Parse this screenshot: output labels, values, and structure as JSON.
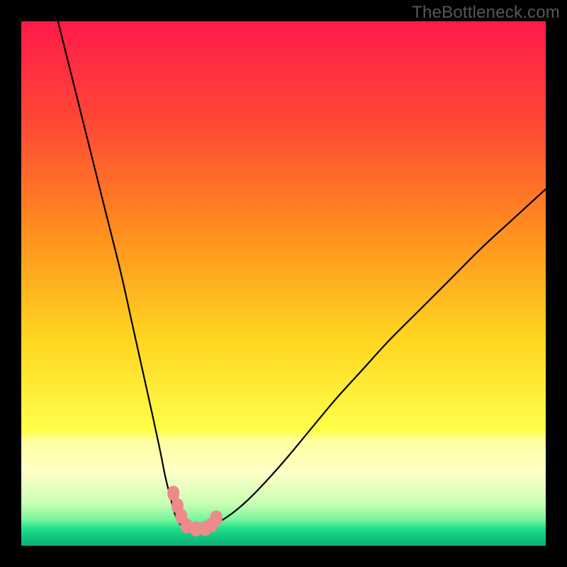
{
  "watermark": "TheBottleneck.com",
  "chart_data": {
    "type": "line",
    "title": "",
    "xlabel": "",
    "ylabel": "",
    "xlim": [
      0,
      100
    ],
    "ylim": [
      0,
      100
    ],
    "background_gradient": {
      "stops": [
        {
          "offset": 0.0,
          "color": "#ff1a49"
        },
        {
          "offset": 0.2,
          "color": "#ff4a34"
        },
        {
          "offset": 0.4,
          "color": "#ff8e1f"
        },
        {
          "offset": 0.6,
          "color": "#ffd41f"
        },
        {
          "offset": 0.78,
          "color": "#ffff4a"
        },
        {
          "offset": 0.8,
          "color": "#ffffa0"
        },
        {
          "offset": 0.86,
          "color": "#ffffc8"
        },
        {
          "offset": 0.92,
          "color": "#c8ffb4"
        },
        {
          "offset": 0.95,
          "color": "#78f59b"
        },
        {
          "offset": 0.967,
          "color": "#22e08a"
        },
        {
          "offset": 0.982,
          "color": "#12c880"
        },
        {
          "offset": 1.0,
          "color": "#0fb074"
        }
      ]
    },
    "series": [
      {
        "name": "left-curve",
        "color": "#000000",
        "width": 2.2,
        "x": [
          7,
          10,
          13,
          16,
          19,
          21,
          23,
          25,
          26.5,
          27.5,
          28.5,
          29,
          29.5,
          30,
          30.7,
          31.7,
          33.2
        ],
        "y": [
          100,
          88,
          76,
          64,
          52,
          43,
          34,
          25,
          18,
          13,
          9,
          7,
          5.5,
          4.5,
          3.8,
          3.3,
          3.1
        ]
      },
      {
        "name": "right-curve",
        "color": "#000000",
        "width": 2.2,
        "x": [
          33.2,
          34.5,
          36.3,
          38.5,
          41.5,
          45,
          50,
          55,
          60,
          65,
          70,
          76,
          82,
          88,
          94,
          100
        ],
        "y": [
          3.1,
          3.3,
          3.9,
          5.0,
          7.2,
          10.5,
          16,
          22,
          28,
          33.5,
          39,
          45,
          51,
          57,
          62.5,
          68
        ]
      }
    ],
    "markers": [
      {
        "x": 29,
        "y": 10,
        "color": "#ed8b8b",
        "size": 4.6
      },
      {
        "x": 29.8,
        "y": 7.6,
        "color": "#ed8b8b",
        "size": 4.6
      },
      {
        "x": 30.5,
        "y": 5.6,
        "color": "#ed8b8b",
        "size": 4.6
      },
      {
        "x": 31.5,
        "y": 3.8,
        "color": "#ed8b8b",
        "size": 4.6
      },
      {
        "x": 33.3,
        "y": 3.2,
        "color": "#ed8b8b",
        "size": 4.6
      },
      {
        "x": 35.1,
        "y": 3.3,
        "color": "#ed8b8b",
        "size": 4.6
      },
      {
        "x": 36.3,
        "y": 4.0,
        "color": "#ed8b8b",
        "size": 4.6
      },
      {
        "x": 37.2,
        "y": 5.3,
        "color": "#ed8b8b",
        "size": 4.6
      }
    ]
  }
}
